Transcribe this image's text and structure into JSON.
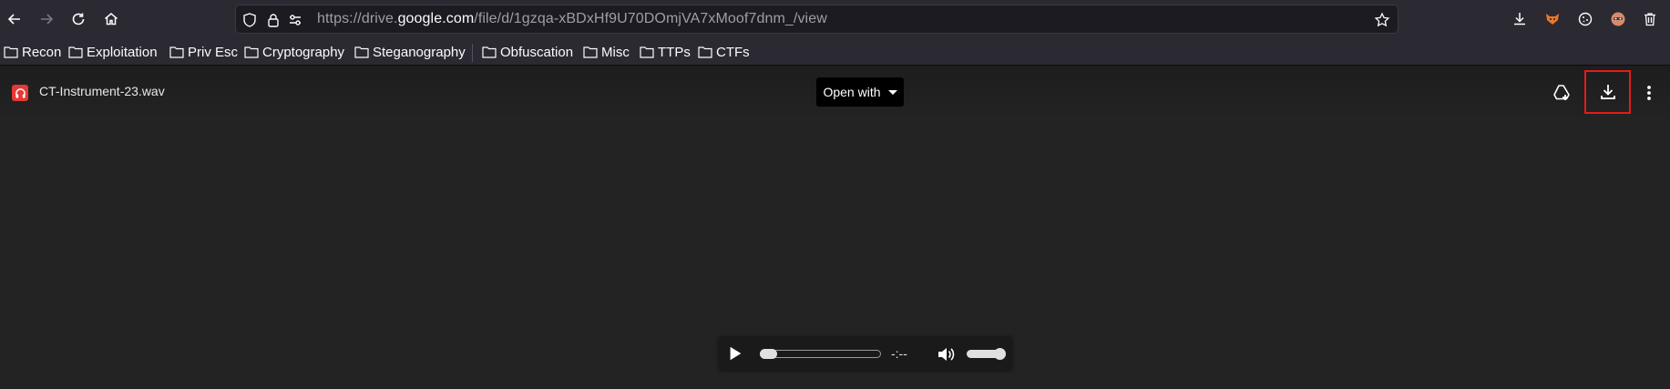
{
  "browser": {
    "url_prefix": "https://drive.",
    "url_host": "google.com",
    "url_path": "/file/d/1gzqa-xBDxHf9U70DOmjVA7xMoof7dnm_/view"
  },
  "bookmarks": [
    {
      "label": "Recon"
    },
    {
      "label": "Exploitation"
    },
    {
      "label": "Priv Esc"
    },
    {
      "label": "Cryptography"
    },
    {
      "label": "Steganography"
    },
    {
      "label": "Obfuscation"
    },
    {
      "label": "Misc"
    },
    {
      "label": "TTPs"
    },
    {
      "label": "CTFs"
    }
  ],
  "drive": {
    "file_name": "CT-Instrument-23.wav",
    "open_with_label": "Open with"
  },
  "player": {
    "time": "-:--",
    "progress": 0,
    "volume": 1.0
  },
  "colors": {
    "highlight": "#e41b1b",
    "file_icon": "#e53935"
  },
  "icons": [
    "back-arrow-icon",
    "forward-arrow-icon",
    "reload-icon",
    "home-icon",
    "shield-icon",
    "lock-icon",
    "permissions-icon",
    "star-icon",
    "downloads-icon",
    "foxyproxy-icon",
    "cookie-icon",
    "avatar-icon",
    "trash-icon",
    "folder-icon",
    "headphones-icon",
    "add-to-drive-icon",
    "download-icon",
    "more-vert-icon",
    "play-icon",
    "volume-icon"
  ]
}
